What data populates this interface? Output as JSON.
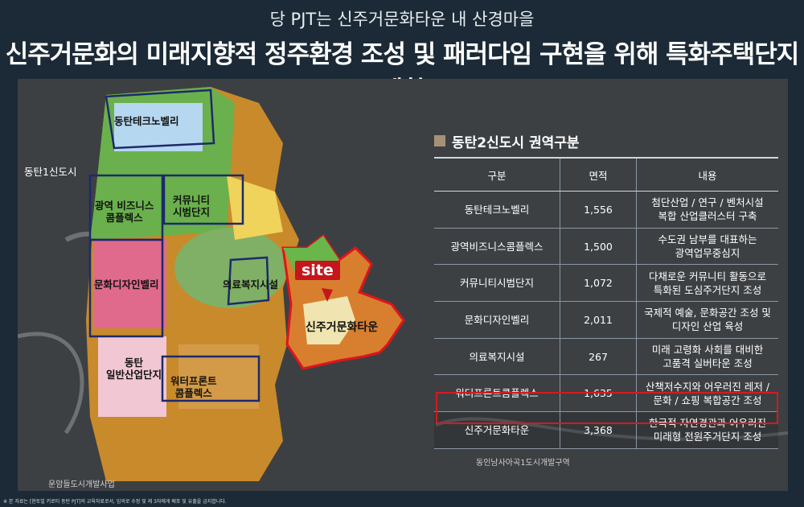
{
  "header": {
    "subtitle": "당 PJT는 신주거문화타운 내 산경마을",
    "title": "신주거문화의 미래지향적 정주환경 조성 및 패러다임 구현을 위해 특화주택단지 계획"
  },
  "map": {
    "labels": {
      "techno": "동탄테크노벨리",
      "dongtan1": "동탄1신도시",
      "biz": "광역 비즈니스\n콤플렉스",
      "community": "커뮤니티\n시범단지",
      "design": "문화디자인벨리",
      "medical": "의료복지시설",
      "industry": "동탄\n일반산업단지",
      "water": "워터프론트\n콤플렉스",
      "newtown": "신주거문화타운",
      "south": "동인남사아곡1도시개발구역",
      "bottom": "운암들도시개발사업",
      "site": "site"
    }
  },
  "panel": {
    "title": "동탄2신도시 권역구분",
    "icon": "square-icon",
    "columns": [
      "구분",
      "면적",
      "내용"
    ],
    "rows": [
      {
        "name": "동탄테크노벨리",
        "area": "1,556",
        "desc": "첨단산업 / 연구 / 벤처시설\n복합 산업클러스터 구축"
      },
      {
        "name": "광역비즈니스콤플렉스",
        "area": "1,500",
        "desc": "수도권 남부를 대표하는\n광역업무중심지"
      },
      {
        "name": "커뮤니티시범단지",
        "area": "1,072",
        "desc": "다채로운 커뮤니티 활동으로\n특화된 도심주거단지 조성"
      },
      {
        "name": "문화디자인벨리",
        "area": "2,011",
        "desc": "국제적 예술, 문화공간 조성 및\n디자인 산업 육성"
      },
      {
        "name": "의료복지시설",
        "area": "267",
        "desc": "미래 고령화 사회를 대비한\n고품격 실버타운 조성"
      },
      {
        "name": "워터프론트콤플렉스",
        "area": "1,635",
        "desc": "산책저수지와 어우러진 레저 /\n문화 / 쇼핑 복합공간 조성"
      },
      {
        "name": "신주거문화타운",
        "area": "3,368",
        "desc": "한국적 자연경관과 어우러진\n미래형 전원주거단지 조성"
      }
    ]
  },
  "footnote": "※ 본 자료는 [현토빌 키로티 동탄 PJT]의 교육자료로서, 임의로 수정 및 제 3자에게 배포 및 유출을 금지합니다.",
  "colors": {
    "background": "#1b2a36",
    "highlight": "#d51a1f",
    "site": "#c4161c"
  }
}
